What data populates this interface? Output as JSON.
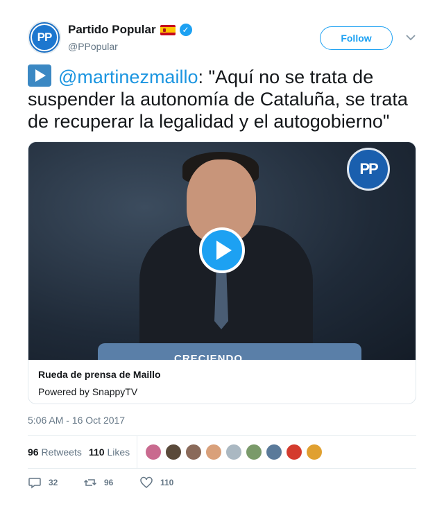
{
  "author": {
    "display_name": "Partido Popular",
    "handle": "@PPopular",
    "avatar_text": "PP",
    "verified": true,
    "flag": "spain-flag-icon"
  },
  "header": {
    "follow_label": "Follow",
    "menu_icon": "chevron-down-icon"
  },
  "tweet": {
    "mention": "@martinezmaillo",
    "text": ": \"Aquí no se trata de suspender la autonomía de Cataluña, se trata de recuperar la legalidad y el autogobierno\""
  },
  "card": {
    "video_logo_text": "PP",
    "podium_text": "CRECIENDO",
    "title": "Rueda de prensa de Maillo",
    "subtitle": "Powered by SnappyTV"
  },
  "timestamp": "5:06 AM - 16 Oct 2017",
  "stats": {
    "retweets_count": "96",
    "retweets_label": "Retweets",
    "likes_count": "110",
    "likes_label": "Likes",
    "liker_avatar_colors": [
      "#c96a8f",
      "#5a4a3a",
      "#8a6a5a",
      "#d9a07a",
      "#aab8c2",
      "#7a9a6a",
      "#5a7a9a",
      "#d43b2e",
      "#e0a030"
    ]
  },
  "actions": {
    "reply_count": "32",
    "retweet_count": "96",
    "like_count": "110"
  },
  "colors": {
    "accent": "#1da1f2",
    "mention": "#1b95e0",
    "secondary_text": "#657786"
  }
}
